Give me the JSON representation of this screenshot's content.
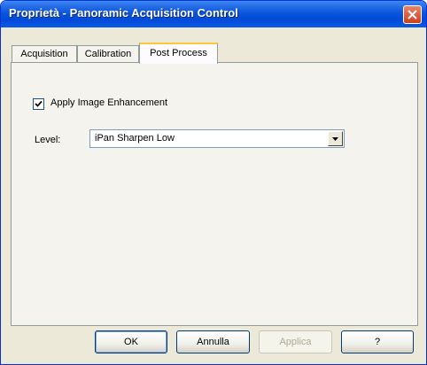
{
  "window": {
    "title": "Proprietà - Panoramic Acquisition Control"
  },
  "tabs": [
    {
      "label": "Acquisition",
      "active": false
    },
    {
      "label": "Calibration",
      "active": false
    },
    {
      "label": "Post Process",
      "active": true
    }
  ],
  "post_process": {
    "enhancement_label": "Apply Image Enhancement",
    "enhancement_checked": true,
    "level_label": "Level:",
    "level_value": "iPan Sharpen Low"
  },
  "buttons": {
    "ok": "OK",
    "cancel": "Annulla",
    "apply": "Applica",
    "help": "?"
  },
  "colors": {
    "title_bar": "#0a56dc",
    "dialog_face": "#ece9d8",
    "close_button": "#cd3f1c",
    "active_tab_highlight": "#ffc83c"
  },
  "icons": [
    "close-icon",
    "checkmark-icon",
    "dropdown-arrow-icon"
  ]
}
